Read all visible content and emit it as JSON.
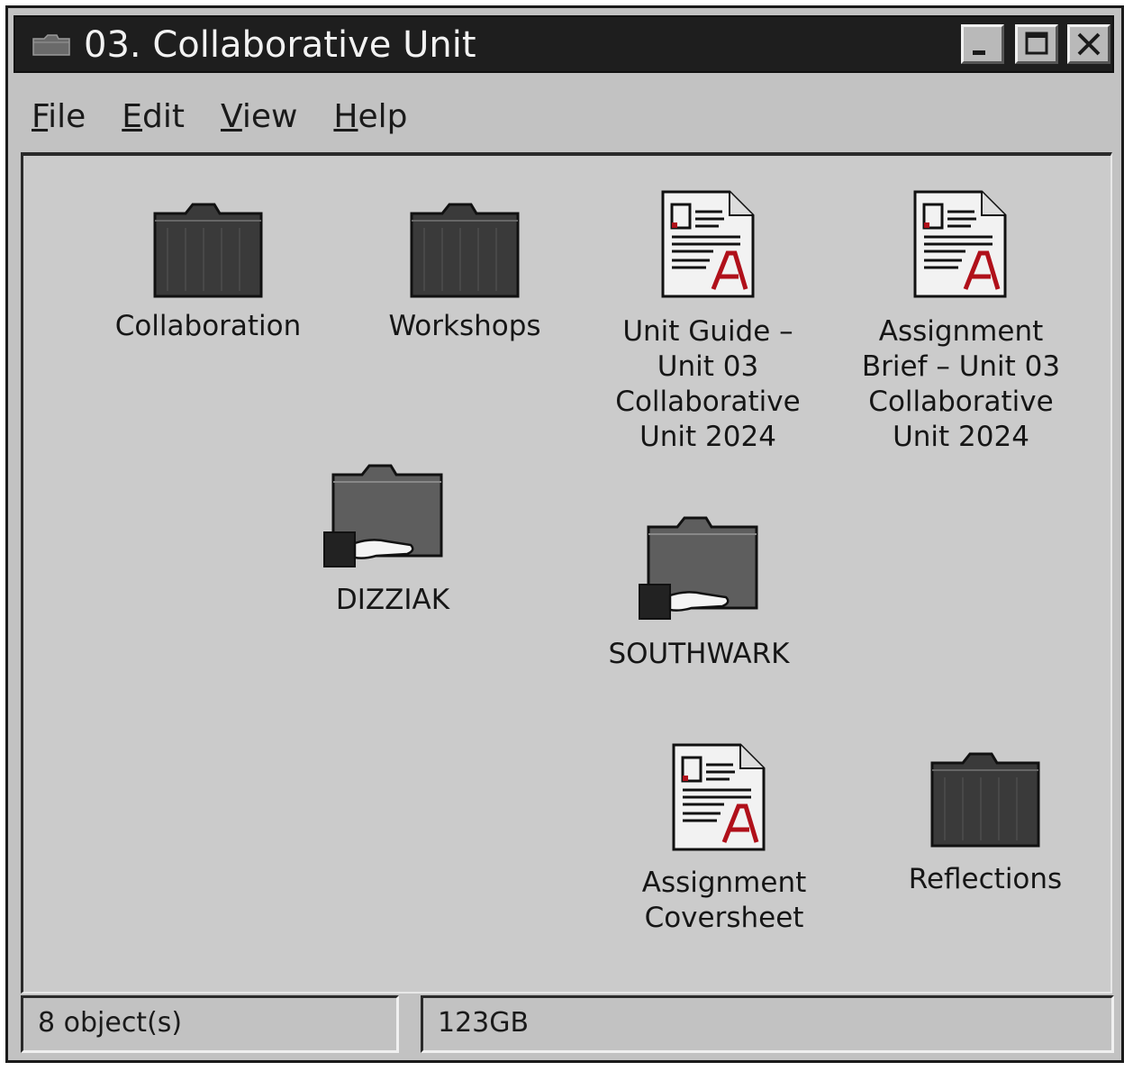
{
  "window": {
    "title": "03. Collaborative Unit",
    "controls": [
      "minimize",
      "maximize",
      "close"
    ]
  },
  "menu": {
    "items": [
      "File",
      "Edit",
      "View",
      "Help"
    ]
  },
  "items": [
    {
      "label": "Collaboration",
      "type": "folder"
    },
    {
      "label": "Workshops",
      "type": "folder"
    },
    {
      "label": "Unit Guide – Unit 03 Collaborative Unit 2024",
      "type": "pdf-document"
    },
    {
      "label": "Assignment Brief – Unit 03 Collaborative Unit 2024",
      "type": "pdf-document"
    },
    {
      "label": "DIZZIAK",
      "type": "shared-folder"
    },
    {
      "label": "SOUTHWARK",
      "type": "shared-folder"
    },
    {
      "label": "Assignment Coversheet",
      "type": "pdf-document"
    },
    {
      "label": "Reflections",
      "type": "folder"
    }
  ],
  "status": {
    "objects": "8 object(s)",
    "size": "123GB"
  },
  "colors": {
    "titlebar": "#1e1e1e",
    "window": "#c2c2c2",
    "pdf_accent": "#b0101a"
  }
}
